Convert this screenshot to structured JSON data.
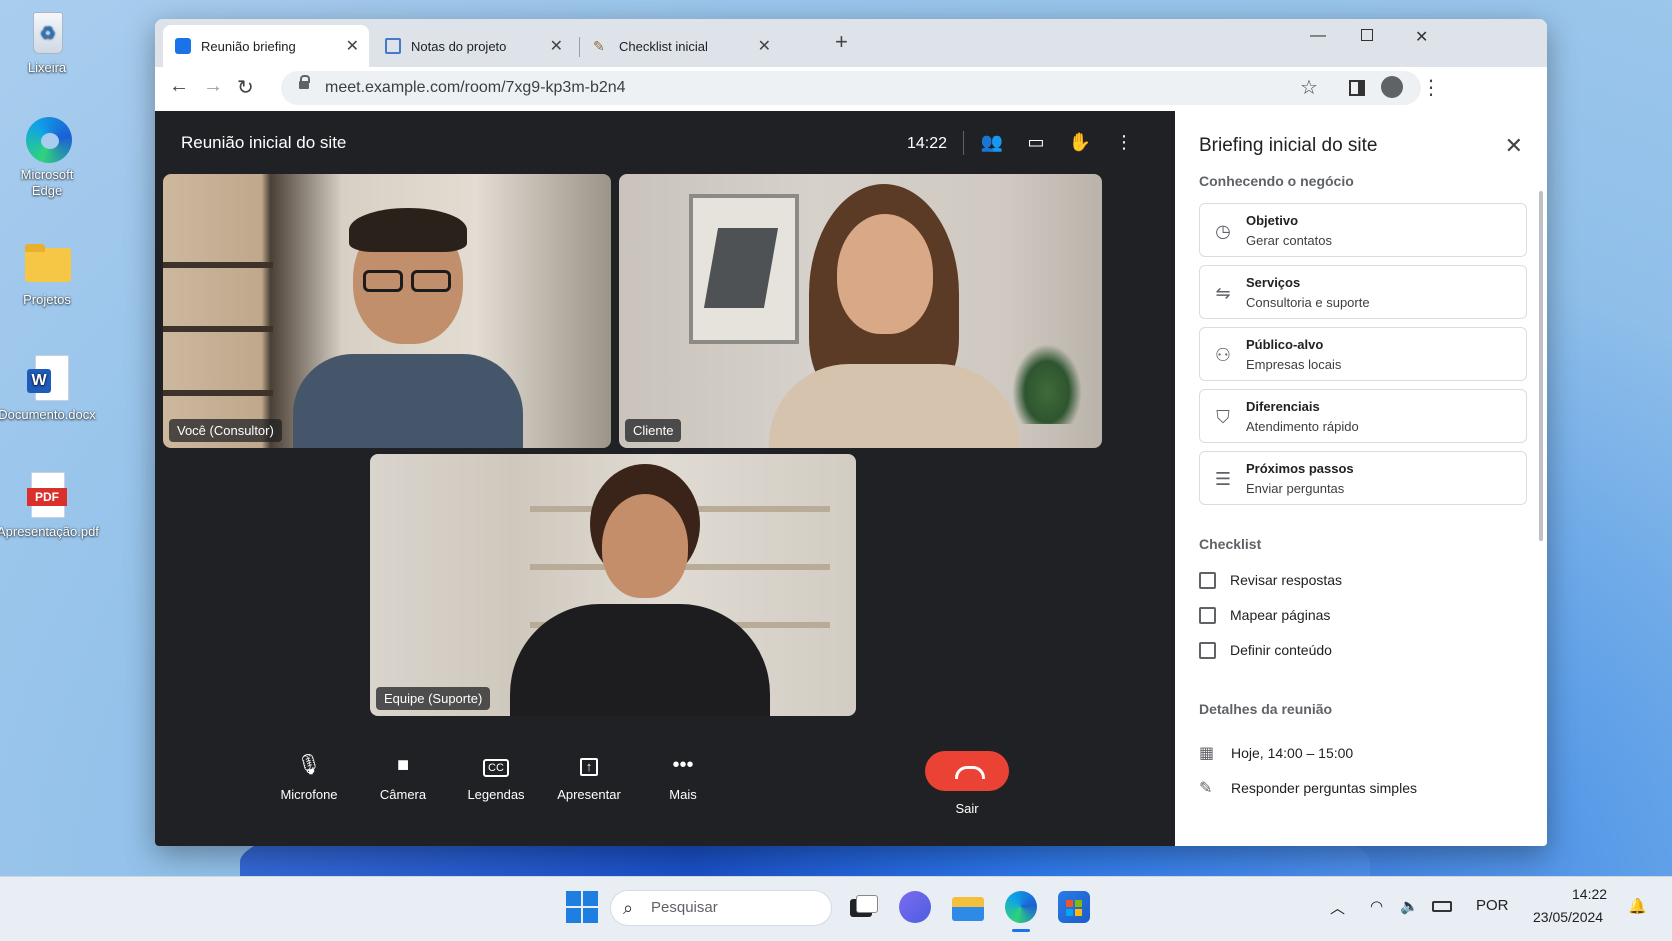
{
  "desktop": {
    "icons": [
      {
        "label": "Lixeira"
      },
      {
        "label": "Microsoft Edge"
      },
      {
        "label": "Projetos"
      },
      {
        "label": "Documento.docx"
      },
      {
        "label": "Apresentação.pdf"
      }
    ],
    "pdf_badge": "PDF"
  },
  "browser": {
    "tabs": [
      {
        "label": "Reunião briefing",
        "icon": "meet-tab-icon"
      },
      {
        "label": "Notas do projeto",
        "icon": "doc-tab-icon"
      },
      {
        "label": "Checklist inicial",
        "icon": "pin-tab-icon"
      }
    ],
    "new_tab": "+",
    "url": "meet.example.com/room/7xg9-kp3m-b2n4"
  },
  "meeting": {
    "title": "Reunião inicial do site",
    "time": "14:22",
    "participants": [
      {
        "name": "Você (Consultor)"
      },
      {
        "name": "Cliente"
      },
      {
        "name": "Equipe (Suporte)"
      }
    ],
    "controls": {
      "mic": "Microfone",
      "camera": "Câmera",
      "captions": "Legendas",
      "present": "Apresentar",
      "more": "Mais",
      "leave": "Sair"
    }
  },
  "panel": {
    "title": "Briefing inicial do site",
    "business_section": "Conhecendo o negócio",
    "cards": [
      {
        "title": "Objetivo",
        "value": "Gerar contatos",
        "icon": "clock-icon"
      },
      {
        "title": "Serviços",
        "value": "Consultoria e suporte",
        "icon": "handshake-icon"
      },
      {
        "title": "Público-alvo",
        "value": "Empresas locais",
        "icon": "people-icon"
      },
      {
        "title": "Diferenciais",
        "value": "Atendimento rápido",
        "icon": "shield-icon"
      },
      {
        "title": "Próximos passos",
        "value": "Enviar perguntas",
        "icon": "list-icon"
      }
    ],
    "checklist_section": "Checklist",
    "checklist": [
      {
        "label": "Revisar respostas",
        "checked": false
      },
      {
        "label": "Mapear páginas",
        "checked": false
      },
      {
        "label": "Definir conteúdo",
        "checked": false
      }
    ],
    "details_section": "Detalhes da reunião",
    "details": {
      "schedule": "Hoje, 14:00 – 15:00",
      "note": "Responder perguntas simples"
    }
  },
  "taskbar": {
    "search_placeholder": "Pesquisar",
    "language": "POR",
    "time": "14:22",
    "date": "23/05/2024"
  },
  "colors": {
    "leave_button": "#ea4335",
    "meeting_bg": "#202124",
    "accent": "#1a73e8"
  }
}
